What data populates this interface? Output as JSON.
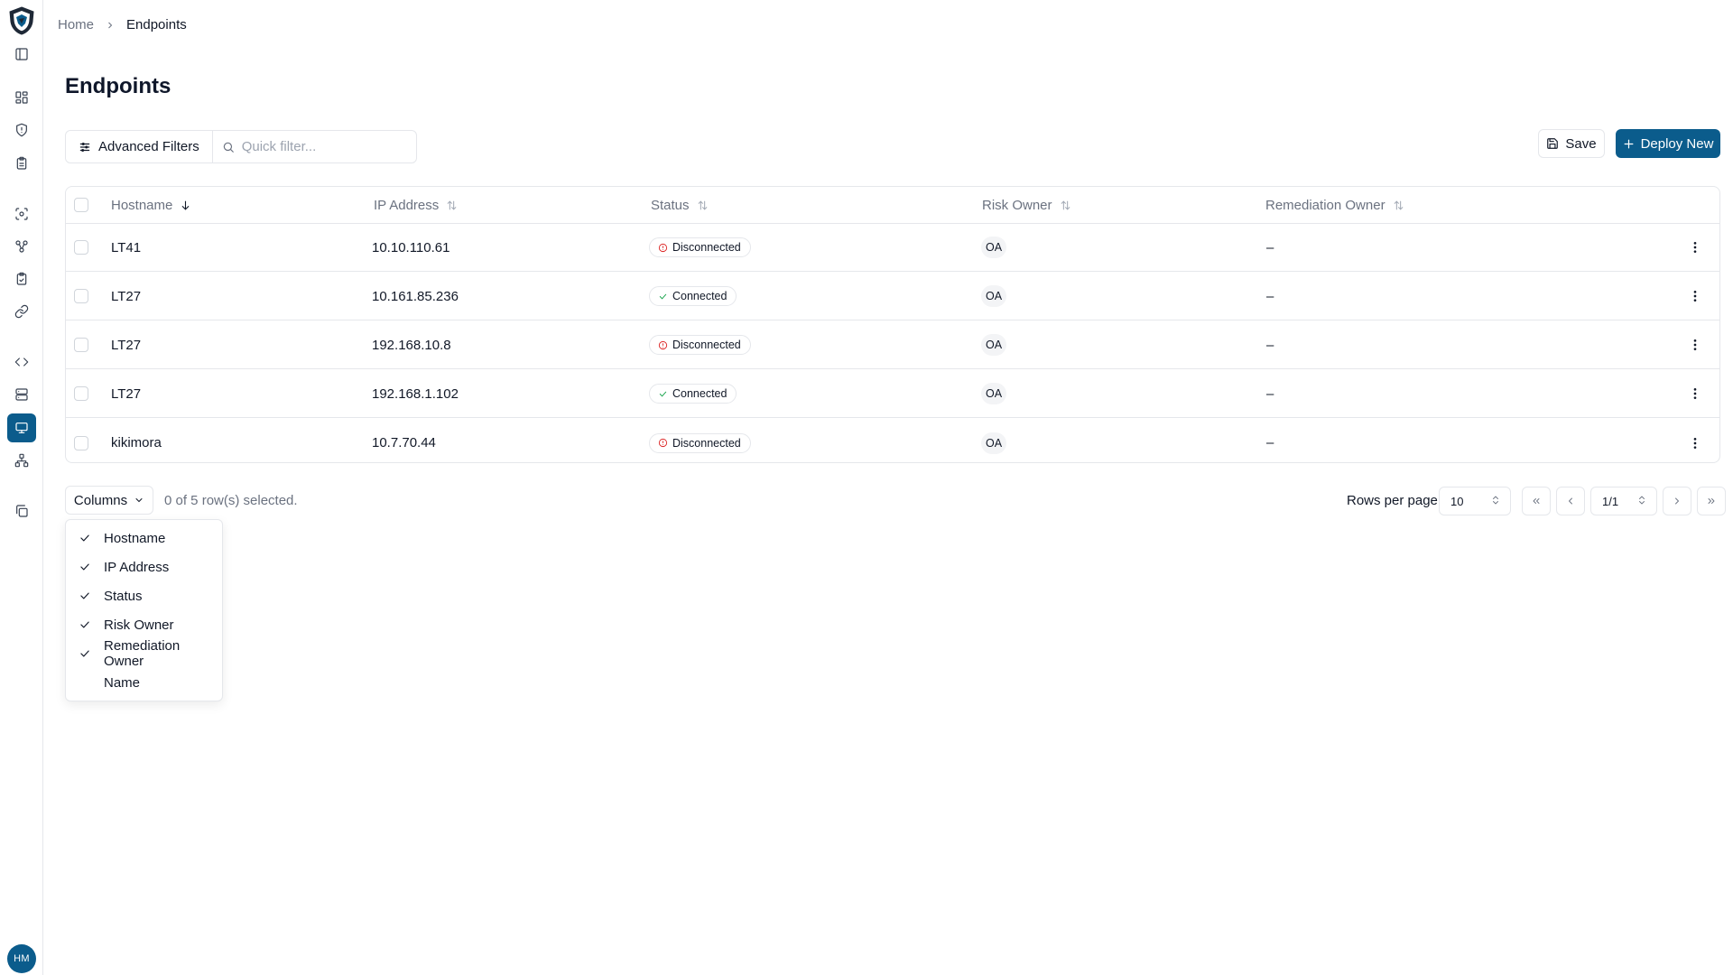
{
  "colors": {
    "brand": "#0b5c8c",
    "disconnected": "#dc2626",
    "connected": "#16a34a"
  },
  "sidebar": {
    "items": [
      {
        "name": "dashboard-icon"
      },
      {
        "name": "shield-icon"
      },
      {
        "name": "clipboard-icon"
      },
      {
        "name": "scan-icon"
      },
      {
        "name": "nodes-icon"
      },
      {
        "name": "clipboard-check-icon"
      },
      {
        "name": "link-icon"
      },
      {
        "name": "code-icon"
      },
      {
        "name": "server-icon"
      },
      {
        "name": "monitor-icon",
        "active": true
      },
      {
        "name": "network-icon"
      },
      {
        "name": "copy-icon"
      }
    ],
    "user_initials": "HM"
  },
  "breadcrumb": {
    "home": "Home",
    "current": "Endpoints"
  },
  "page": {
    "title": "Endpoints"
  },
  "toolbar": {
    "advanced_filters": "Advanced Filters",
    "quick_filter_placeholder": "Quick filter...",
    "save": "Save",
    "deploy": "Deploy New"
  },
  "table": {
    "columns": [
      "Hostname",
      "IP Address",
      "Status",
      "Risk Owner",
      "Remediation Owner"
    ],
    "sorted_column": "Hostname",
    "rows": [
      {
        "hostname": "LT41",
        "ip": "10.10.110.61",
        "status": "Disconnected",
        "risk_owner": "OA",
        "remediation_owner": "–"
      },
      {
        "hostname": "LT27",
        "ip": "10.161.85.236",
        "status": "Connected",
        "risk_owner": "OA",
        "remediation_owner": "–"
      },
      {
        "hostname": "LT27",
        "ip": "192.168.10.8",
        "status": "Disconnected",
        "risk_owner": "OA",
        "remediation_owner": "–"
      },
      {
        "hostname": "LT27",
        "ip": "192.168.1.102",
        "status": "Connected",
        "risk_owner": "OA",
        "remediation_owner": "–"
      },
      {
        "hostname": "kikimora",
        "ip": "10.7.70.44",
        "status": "Disconnected",
        "risk_owner": "OA",
        "remediation_owner": "–"
      }
    ]
  },
  "footer": {
    "columns_button": "Columns",
    "selected_text": "0 of 5 row(s) selected.",
    "rows_per_page_label": "Rows per page",
    "rows_per_page_value": "10",
    "page_value": "1/1"
  },
  "columns_menu": {
    "items": [
      {
        "label": "Hostname",
        "checked": true
      },
      {
        "label": "IP Address",
        "checked": true
      },
      {
        "label": "Status",
        "checked": true
      },
      {
        "label": "Risk Owner",
        "checked": true
      },
      {
        "label": "Remediation Owner",
        "checked": true
      },
      {
        "label": "Name",
        "checked": false
      }
    ]
  }
}
